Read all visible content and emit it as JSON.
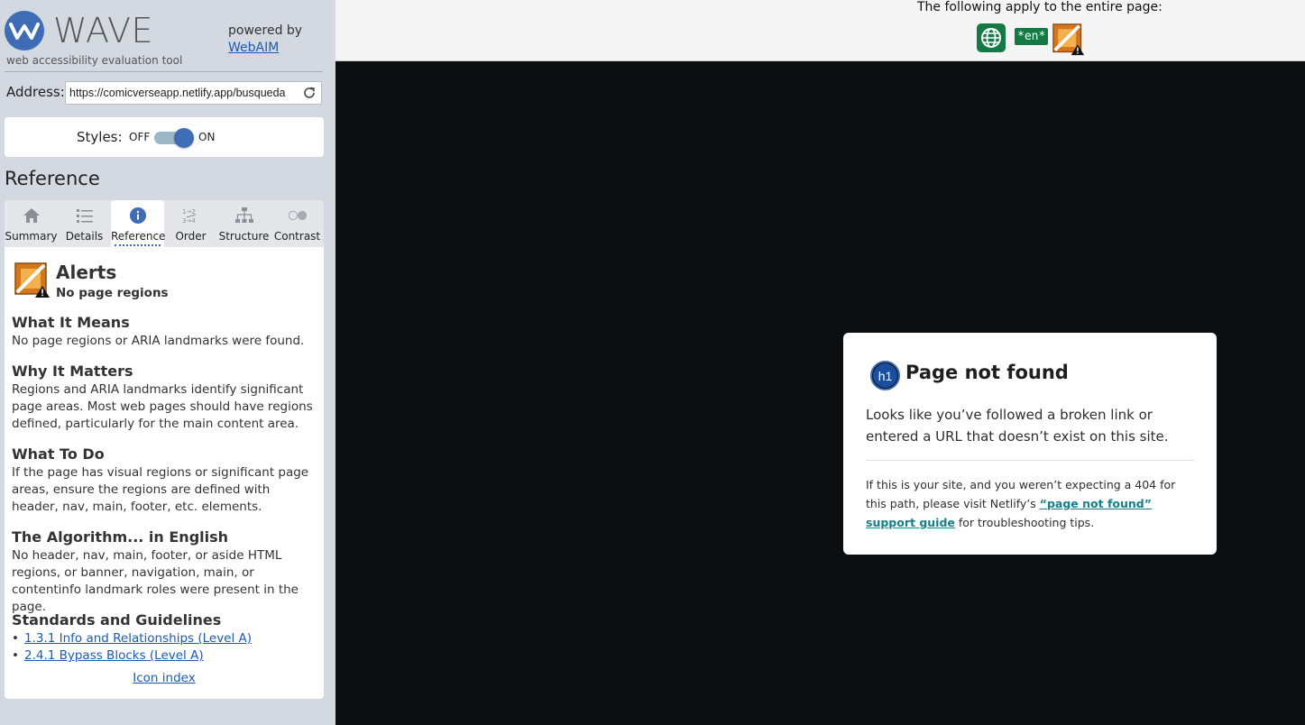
{
  "sidebar": {
    "logo_title": "WAVE",
    "tagline": "web accessibility evaluation tool",
    "powered_by": "powered by",
    "webaim_link": "WebAIM",
    "address_label": "Address:",
    "address_value": "https://comicverseapp.netlify.app/busqueda",
    "styles_label": "Styles:",
    "styles_off": "OFF",
    "styles_on": "ON",
    "section_heading": "Reference",
    "tabs": [
      {
        "label": "Summary",
        "icon": "home-icon"
      },
      {
        "label": "Details",
        "icon": "list-icon"
      },
      {
        "label": "Reference",
        "icon": "info-icon",
        "active": true
      },
      {
        "label": "Order",
        "icon": "order-icon"
      },
      {
        "label": "Structure",
        "icon": "structure-icon"
      },
      {
        "label": "Contrast",
        "icon": "contrast-icon"
      }
    ]
  },
  "reference": {
    "category": "Alerts",
    "item": "No page regions",
    "what_it_means_h": "What It Means",
    "what_it_means": "No page regions or ARIA landmarks were found.",
    "why_it_matters_h": "Why It Matters",
    "why_it_matters": "Regions and ARIA landmarks identify significant page areas. Most web pages should have regions defined, particularly for the main content area.",
    "what_to_do_h": "What To Do",
    "what_to_do": "If the page has visual regions or significant page areas, ensure the regions are defined with header, nav, main, footer, etc. elements.",
    "algorithm_h": "The Algorithm... in English",
    "algorithm": "No header, nav, main, footer, or aside HTML regions, or banner, navigation, main, or contentinfo landmark roles were present in the page.",
    "standards_h": "Standards and Guidelines",
    "standards": [
      "1.3.1 Info and Relationships (Level A)",
      "2.4.1 Bypass Blocks (Level A)"
    ],
    "icon_index": "Icon index"
  },
  "topbar": {
    "caption": "The following apply to the entire page:",
    "lang_badge": "*en*"
  },
  "page": {
    "h1_badge": "h1",
    "title": "Page not found",
    "text": "Looks like you’ve followed a broken link or entered a URL that doesn’t exist on this site.",
    "small_before": "If this is your site, and you weren’t expecting a 404 for this path, please visit Netlify’s ",
    "small_link": "“page not found” support guide",
    "small_after": " for troubleshooting tips."
  },
  "colors": {
    "wave_blue": "#3f6db5",
    "page_icon_green": "#127a42",
    "link_blue": "#1a5bb5",
    "netlify_link": "#14808a"
  }
}
